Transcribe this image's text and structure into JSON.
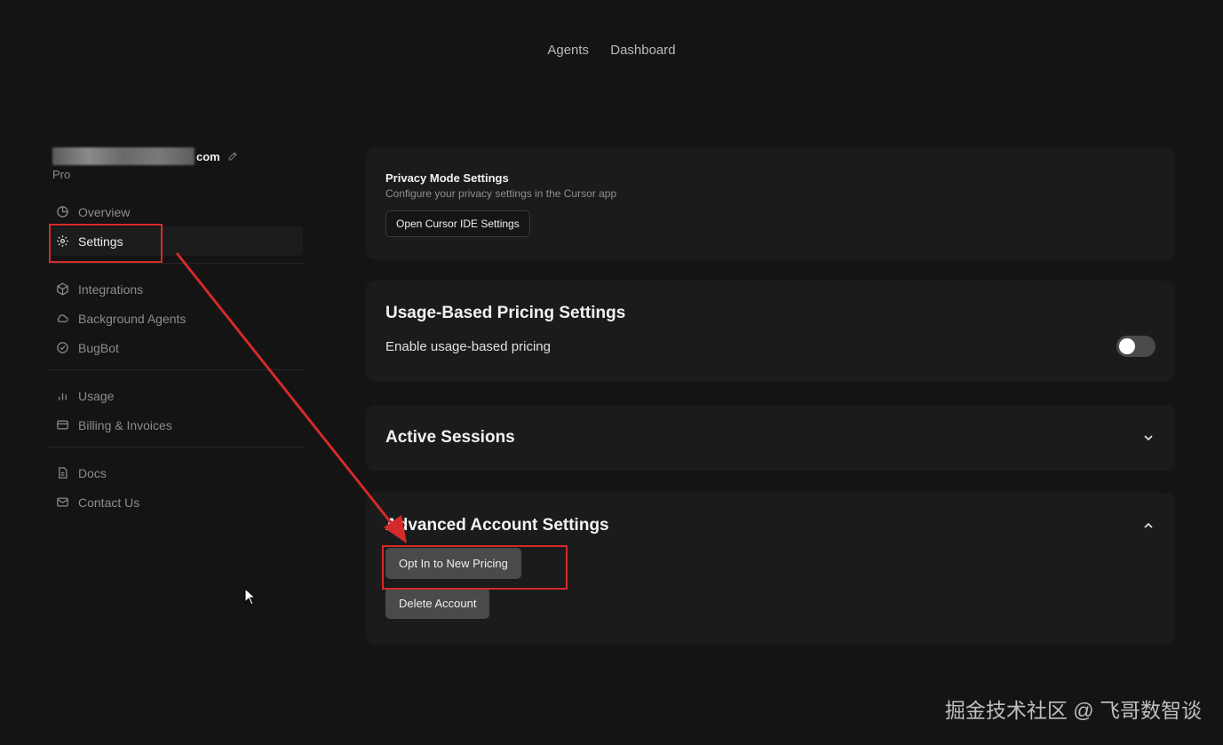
{
  "top_nav": {
    "agents": "Agents",
    "dashboard": "Dashboard"
  },
  "account": {
    "email_suffix": "com",
    "plan": "Pro"
  },
  "sidebar": {
    "group1": [
      {
        "label": "Overview",
        "icon": "pie-chart-icon"
      },
      {
        "label": "Settings",
        "icon": "gear-icon",
        "active": true
      }
    ],
    "group2": [
      {
        "label": "Integrations",
        "icon": "cube-icon"
      },
      {
        "label": "Background Agents",
        "icon": "cloud-icon"
      },
      {
        "label": "BugBot",
        "icon": "check-circle-icon"
      }
    ],
    "group3": [
      {
        "label": "Usage",
        "icon": "bar-chart-icon"
      },
      {
        "label": "Billing & Invoices",
        "icon": "credit-card-icon"
      }
    ],
    "group4": [
      {
        "label": "Docs",
        "icon": "document-icon"
      },
      {
        "label": "Contact Us",
        "icon": "mail-icon"
      }
    ]
  },
  "privacy": {
    "title": "Privacy Mode Settings",
    "desc": "Configure your privacy settings in the Cursor app",
    "button": "Open Cursor IDE Settings"
  },
  "usage_pricing": {
    "title": "Usage-Based Pricing Settings",
    "toggle_label": "Enable usage-based pricing",
    "enabled": false
  },
  "sessions": {
    "title": "Active Sessions"
  },
  "advanced": {
    "title": "Advanced Account Settings",
    "opt_in": "Opt In to New Pricing",
    "delete": "Delete Account"
  },
  "watermark": "掘金技术社区 @ 飞哥数智谈",
  "colors": {
    "background": "#141414",
    "card": "#1b1b1c",
    "highlight": "#d42a2a",
    "button": "#4a4a4a"
  }
}
